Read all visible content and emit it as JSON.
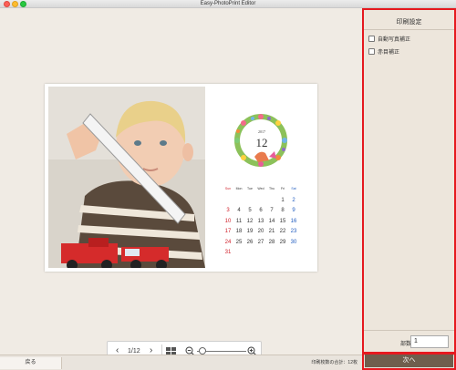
{
  "window": {
    "title": "Easy-PhotoPrint Editor"
  },
  "sidebar": {
    "title": "印刷設定",
    "options": [
      {
        "label": "自動写真補正",
        "checked": false
      },
      {
        "label": "赤目補正",
        "checked": false
      }
    ],
    "copies_label": "部数",
    "copies_value": "1"
  },
  "calendar": {
    "year": "2017",
    "month": "12",
    "weekday_headers": [
      "Sun",
      "Mon",
      "Tue",
      "Wed",
      "Thu",
      "Fri",
      "Sat"
    ],
    "weeks": [
      [
        "",
        "",
        "",
        "",
        "",
        "1",
        "2"
      ],
      [
        "3",
        "4",
        "5",
        "6",
        "7",
        "8",
        "9"
      ],
      [
        "10",
        "11",
        "12",
        "13",
        "14",
        "15",
        "16"
      ],
      [
        "17",
        "18",
        "19",
        "20",
        "21",
        "22",
        "23"
      ],
      [
        "24",
        "25",
        "26",
        "27",
        "28",
        "29",
        "30"
      ],
      [
        "31",
        "",
        "",
        "",
        "",
        "",
        ""
      ]
    ]
  },
  "navigation": {
    "page_counter": "1/12",
    "zoom_level": 0.05
  },
  "bottom": {
    "back_label": "戻る",
    "total_label": "印刷枚数の合計：12枚",
    "next_label": "次へ"
  },
  "colors": {
    "highlight": "#e5191f",
    "next_button": "#6f5e4d",
    "sunday": "#d0202a",
    "saturday": "#1f5bbf"
  }
}
